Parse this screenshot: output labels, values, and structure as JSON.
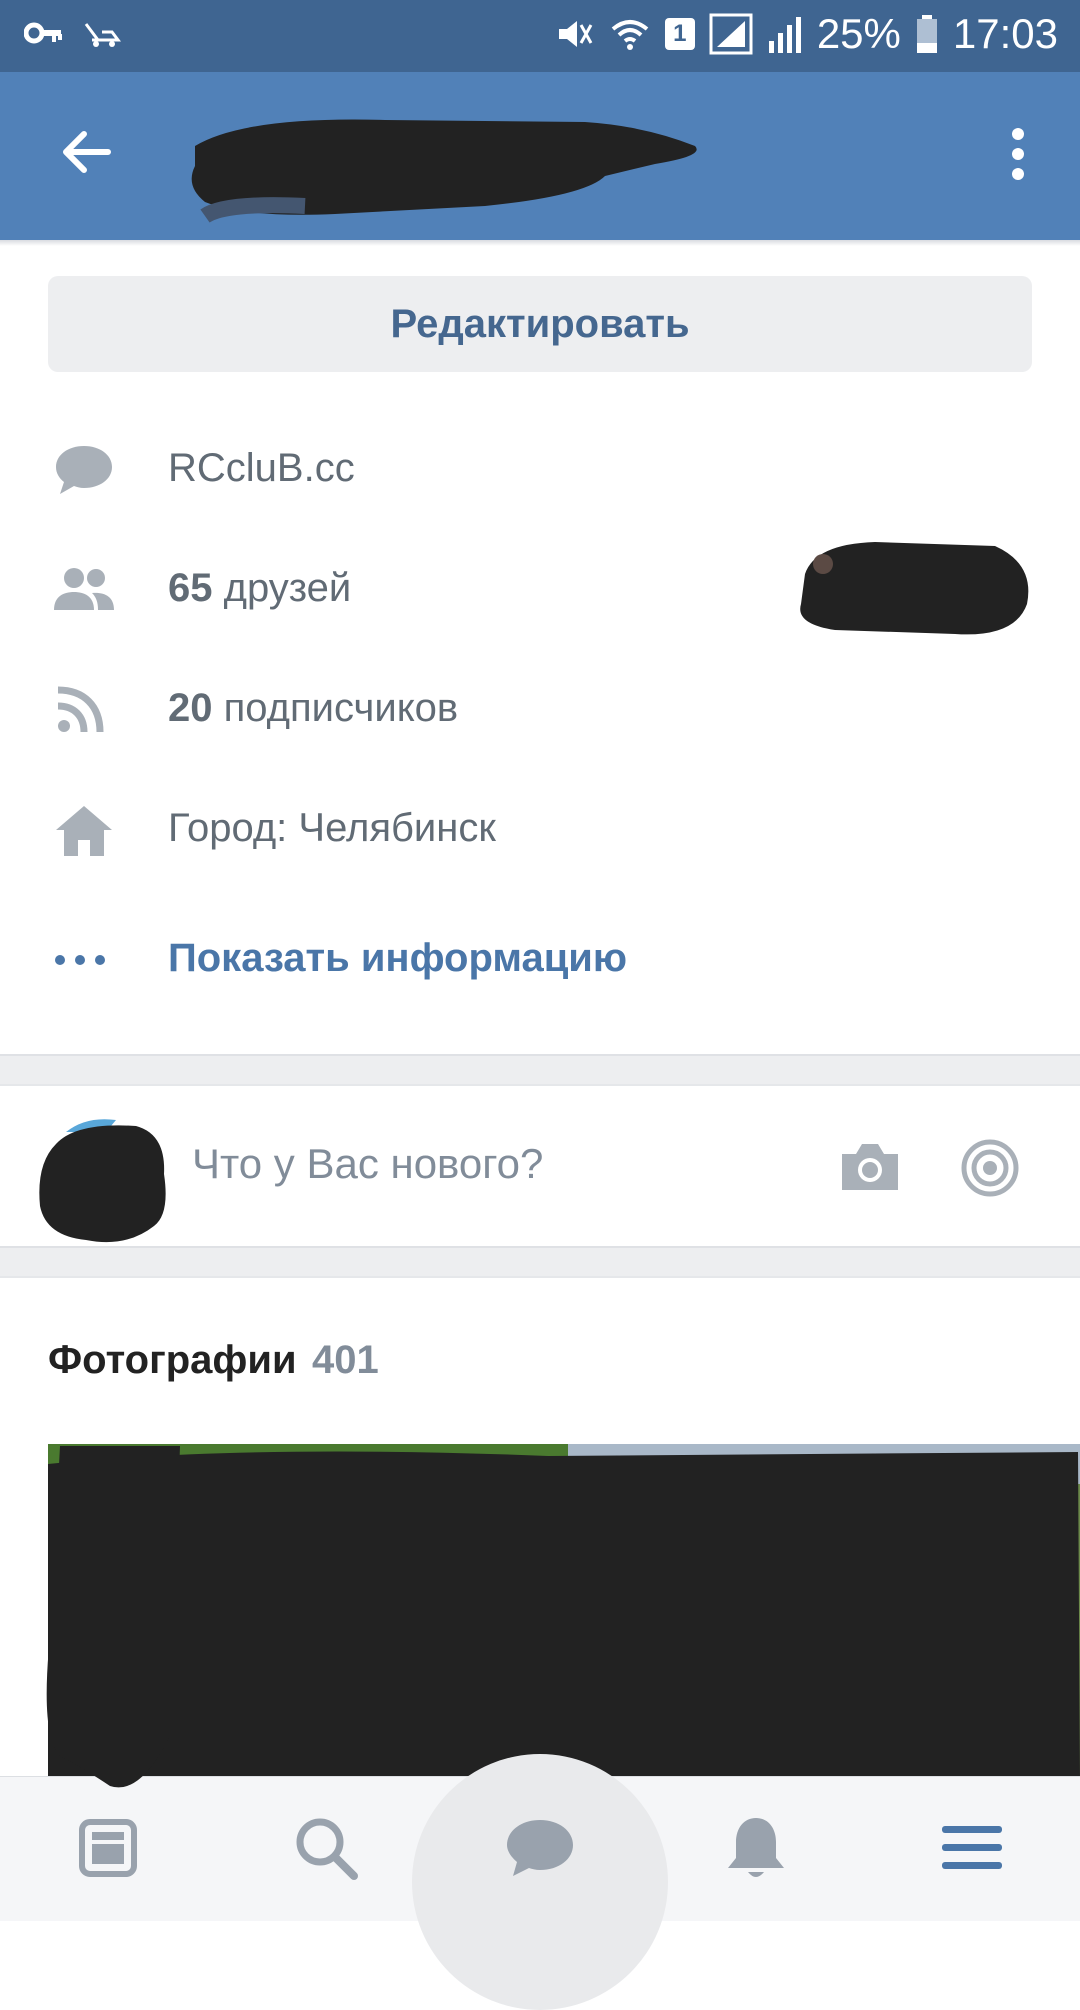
{
  "status_bar": {
    "battery": "25%",
    "time": "17:03",
    "sim": "1"
  },
  "header": {
    "back_icon": "arrow-left-icon",
    "more_icon": "more-vertical-icon"
  },
  "profile": {
    "edit_label": "Редактировать",
    "status_text": "RCcluB.cc",
    "friends_count": "65",
    "friends_label": "друзей",
    "followers_count": "20",
    "followers_label": "подписчиков",
    "city": "Город: Челябинск",
    "show_info_label": "Показать информацию"
  },
  "post_box": {
    "placeholder": "Что у Вас нового?"
  },
  "photos": {
    "title": "Фотографии",
    "count": "401"
  },
  "bottom_nav": {
    "items": [
      "news-icon",
      "search-icon",
      "messages-icon",
      "notifications-icon",
      "menu-icon"
    ],
    "active": "messages-icon"
  },
  "colors": {
    "status_bar": "#3f6591",
    "app_bar": "#5181b8",
    "accent": "#4a76a8",
    "redaction": "#222222"
  }
}
